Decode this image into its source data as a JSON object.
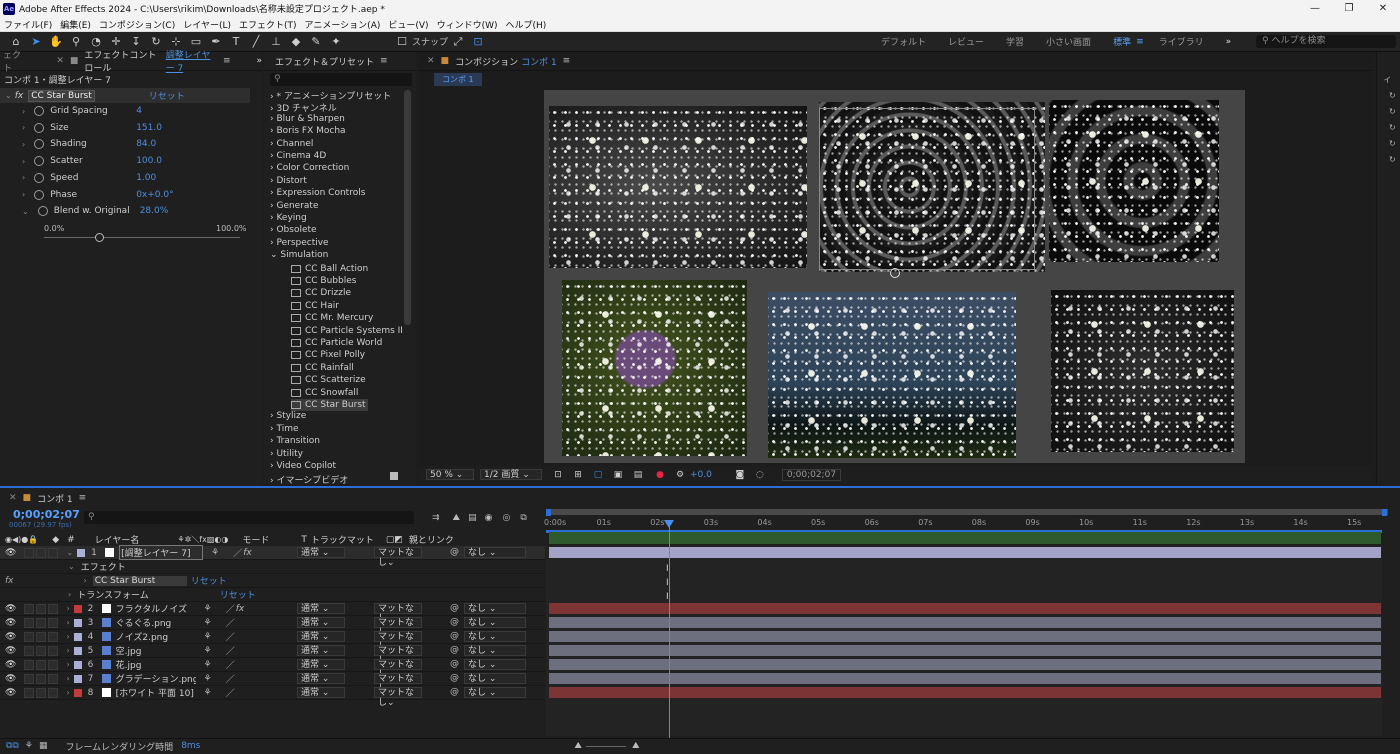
{
  "app": {
    "title": "Adobe After Effects 2024 - C:\\Users\\rikim\\Downloads\\名称未設定プロジェクト.aep *",
    "logo": "Ae"
  },
  "menu": [
    "ファイル(F)",
    "編集(E)",
    "コンポジション(C)",
    "レイヤー(L)",
    "エフェクト(T)",
    "アニメーション(A)",
    "ビュー(V)",
    "ウィンドウ(W)",
    "ヘルプ(H)"
  ],
  "toolbar": {
    "snap_label": "スナップ",
    "workspaces": [
      "デフォルト",
      "レビュー",
      "学習",
      "小さい画面",
      "標準",
      "ライブラリ"
    ],
    "active_workspace": "標準",
    "more": "»",
    "help_placeholder": "ヘルプを検索"
  },
  "effect_controls": {
    "left_tab": "ェクト",
    "tab_label": "エフェクトコントロール",
    "tab_target": "調整レイヤー 7",
    "breadcrumb": "コンポ 1・調整レイヤー 7",
    "effect_name": "CC Star Burst",
    "reset": "リセット",
    "props": [
      {
        "label": "Grid Spacing",
        "value": "4"
      },
      {
        "label": "Size",
        "value": "151.0"
      },
      {
        "label": "Shading",
        "value": "84.0"
      },
      {
        "label": "Scatter",
        "value": "100.0"
      },
      {
        "label": "Speed",
        "value": "1.00"
      },
      {
        "label": "Phase",
        "value": "0x+0.0°"
      },
      {
        "label": "Blend w. Original",
        "value": "28.0%"
      }
    ],
    "slider_min": "0.0%",
    "slider_max": "100.0%",
    "blend_fraction": 0.28
  },
  "effects_presets": {
    "tab_label": "エフェクト＆プリセット",
    "search_placeholder": "",
    "categories_top": [
      "* アニメーションプリセット",
      "3D チャンネル",
      "Blur & Sharpen",
      "Boris FX Mocha",
      "Channel",
      "Cinema 4D",
      "Color Correction",
      "Distort",
      "Expression Controls",
      "Generate",
      "Keying",
      "Obsolete",
      "Perspective"
    ],
    "expanded_category": "Simulation",
    "simulation_items": [
      "CC Ball Action",
      "CC Bubbles",
      "CC Drizzle",
      "CC Hair",
      "CC Mr. Mercury",
      "CC Particle Systems II",
      "CC Particle World",
      "CC Pixel Polly",
      "CC Rainfall",
      "CC Scatterize",
      "CC Snowfall",
      "CC Star Burst"
    ],
    "selected_item": "CC Star Burst",
    "categories_bottom": [
      "Stylize",
      "Time",
      "Transition",
      "Utility",
      "Video Copilot",
      "イマーシブビデオ"
    ]
  },
  "composition": {
    "tab_label": "コンポジション",
    "comp_name": "コンポ 1",
    "subtab": "コンポ 1",
    "zoom": "50 %",
    "resolution": "1/2 画質",
    "exposure": "+0.0",
    "timecode": "0;00;02;07"
  },
  "timeline": {
    "tab_label": "コンポ 1",
    "timecode": "0;00;02;07",
    "frames_fps": "00067 (29.97 fps)",
    "search_placeholder": "",
    "col_layer_name": "レイヤー名",
    "col_mode": "モード",
    "col_t": "T",
    "col_trackmatte": "トラックマット",
    "col_parent": "親とリンク",
    "effect_group": "エフェクト",
    "effect_item": "CC Star Burst",
    "transform_group": "トランスフォーム",
    "reset": "リセット",
    "fx_label": "fx",
    "layers": [
      {
        "num": "1",
        "name": "[調整レイヤー 7]",
        "mode": "通常",
        "matte": "マットなし",
        "parent": "なし",
        "color": "#aab0d8",
        "bar": "#a5a2c8"
      },
      {
        "num": "2",
        "name": "フラクタルノイズ",
        "mode": "通常",
        "matte": "マットなし",
        "parent": "なし",
        "color": "#c23b3b",
        "bar": "#7d3434"
      },
      {
        "num": "3",
        "name": "ぐるぐる.png",
        "mode": "通常",
        "matte": "マットなし",
        "parent": "なし",
        "color": "#aab0d8",
        "bar": "#6e6f7e"
      },
      {
        "num": "4",
        "name": "ノイズ2.png",
        "mode": "通常",
        "matte": "マットなし",
        "parent": "なし",
        "color": "#aab0d8",
        "bar": "#6e6f7e"
      },
      {
        "num": "5",
        "name": "空.jpg",
        "mode": "通常",
        "matte": "マットなし",
        "parent": "なし",
        "color": "#aab0d8",
        "bar": "#6e6f7e"
      },
      {
        "num": "6",
        "name": "花.jpg",
        "mode": "通常",
        "matte": "マットなし",
        "parent": "なし",
        "color": "#aab0d8",
        "bar": "#6e6f7e"
      },
      {
        "num": "7",
        "name": "グラデーション.png",
        "mode": "通常",
        "matte": "マットなし",
        "parent": "なし",
        "color": "#aab0d8",
        "bar": "#6e6f7e"
      },
      {
        "num": "8",
        "name": "[ホワイト 平面 10]",
        "mode": "通常",
        "matte": "マットなし",
        "parent": "なし",
        "color": "#c23b3b",
        "bar": "#7d3434"
      }
    ],
    "ruler": [
      "0:00s",
      "01s",
      "02s",
      "03s",
      "04s",
      "05s",
      "06s",
      "07s",
      "08s",
      "09s",
      "10s",
      "11s",
      "12s",
      "13s",
      "14s",
      "15s"
    ],
    "playhead_seconds": 2.23,
    "footer_label": "フレームレンダリング時間",
    "footer_value": "8ms"
  }
}
